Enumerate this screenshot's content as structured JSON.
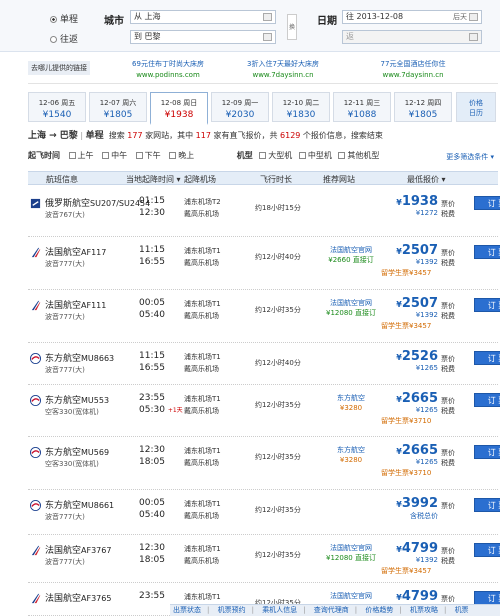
{
  "search": {
    "one_way": "单程",
    "round_trip": "往返",
    "city_label": "城市",
    "date_label": "日期",
    "from": "从 上海",
    "to": "到 巴黎",
    "depart_date": "往 2013-12-08",
    "depart_hint": "后天",
    "return_date": "返",
    "swap": "换"
  },
  "ads": {
    "intro": "去哪儿提供的链接",
    "items": [
      {
        "title": "69元住布丁时尚大床房",
        "url": "www.podinns.com"
      },
      {
        "title": "3折入住7天最好大床房",
        "url": "www.7daysinn.cn"
      },
      {
        "title": "77元全国酒店任你住",
        "url": "www.7daysinn.cn"
      }
    ]
  },
  "dates": [
    {
      "label": "12-06 周五",
      "price": "¥1540"
    },
    {
      "label": "12-07 周六",
      "price": "¥1805"
    },
    {
      "label": "12-08 周日",
      "price": "¥1938"
    },
    {
      "label": "12-09 周一",
      "price": "¥2030"
    },
    {
      "label": "12-10 周二",
      "price": "¥1830"
    },
    {
      "label": "12-11 周三",
      "price": "¥1088"
    },
    {
      "label": "12-12 周四",
      "price": "¥1805"
    }
  ],
  "trend": {
    "l1": "价格",
    "l2": "日历"
  },
  "summary": {
    "route": "上海 → 巴黎",
    "type": "单程",
    "t1": "搜索",
    "n1": "177",
    "t2": "家网站，其中",
    "n2": "117",
    "t3": "家有直飞报价，共",
    "n3": "6129",
    "t4": "个报价信息，搜索结束"
  },
  "filter": {
    "time_label": "起飞时间",
    "times": [
      "上午",
      "中午",
      "下午",
      "晚上"
    ],
    "type_label": "机型",
    "types": [
      "大型机",
      "中型机",
      "其他机型"
    ],
    "more": "更多筛选条件 ▾"
  },
  "table_headers": {
    "flight": "航班信息",
    "time": "当地起降时间 ▾",
    "airport": "起降机场",
    "duration": "飞行时长",
    "agent": "推荐网站",
    "price": "最低报价 ▾"
  },
  "flights": [
    {
      "airline": "俄罗斯航空",
      "code": "SU207/SU2454",
      "plane": "波音767(大)",
      "dep": "01:15",
      "arr": "12:30",
      "ap1": "浦东机场T2",
      "ap2": "戴高乐机场",
      "dur": "约18小时15分",
      "ag1": "",
      "ag2": "",
      "price": "1938",
      "ptag": "票价",
      "tax": "¥1272",
      "taxl": "税费",
      "ins": "",
      "insv": "",
      "book": "订 票"
    },
    {
      "airline": "法国航空",
      "code": "AF117",
      "plane": "波音777(大)",
      "dep": "11:15",
      "arr": "16:55",
      "ap1": "浦东机场T1",
      "ap2": "戴高乐机场",
      "dur": "约12小时40分",
      "ag1": "法国航空官网",
      "ag2": "¥2660 直接订",
      "price": "2507",
      "ptag": "票价",
      "tax": "¥1392",
      "taxl": "税费",
      "ins": "留学生票",
      "insv": "¥3457",
      "book": "订 票"
    },
    {
      "airline": "法国航空",
      "code": "AF111",
      "plane": "波音777(大)",
      "dep": "00:05",
      "arr": "05:40",
      "ap1": "浦东机场T1",
      "ap2": "戴高乐机场",
      "dur": "约12小时35分",
      "ag1": "法国航空官网",
      "ag2": "¥12080 直接订",
      "price": "2507",
      "ptag": "票价",
      "tax": "¥1392",
      "taxl": "税费",
      "ins": "留学生票",
      "insv": "¥3457",
      "book": "订 票"
    },
    {
      "airline": "东方航空",
      "code": "MU8663",
      "plane": "波音777(大)",
      "dep": "11:15",
      "arr": "16:55",
      "ap1": "浦东机场T1",
      "ap2": "戴高乐机场",
      "dur": "约12小时40分",
      "ag1": "",
      "ag2": "",
      "price": "2526",
      "ptag": "票价",
      "tax": "¥1265",
      "taxl": "税费",
      "ins": "",
      "insv": "",
      "book": "订 票"
    },
    {
      "airline": "东方航空",
      "code": "MU553",
      "plane": "空客330(宽体机)",
      "dep": "23:55",
      "arr": "05:30",
      "ap1": "浦东机场T1",
      "ap2": "戴高乐机场",
      "dur": "约12小时35分",
      "ag1": "东方航空",
      "ag2": "¥3280",
      "price": "2665",
      "ptag": "票价",
      "tax": "¥1265",
      "taxl": "税费",
      "ins": "留学生票",
      "insv": "¥3710",
      "book": "订 票"
    },
    {
      "airline": "东方航空",
      "code": "MU569",
      "plane": "空客330(宽体机)",
      "dep": "12:30",
      "arr": "18:05",
      "ap1": "浦东机场T1",
      "ap2": "戴高乐机场",
      "dur": "约12小时35分",
      "ag1": "东方航空",
      "ag2": "¥3280",
      "price": "2665",
      "ptag": "票价",
      "tax": "¥1265",
      "taxl": "税费",
      "ins": "留学生票",
      "insv": "¥3710",
      "book": "订 票"
    },
    {
      "airline": "东方航空",
      "code": "MU8661",
      "plane": "波音777(大)",
      "dep": "00:05",
      "arr": "05:40",
      "ap1": "浦东机场T1",
      "ap2": "戴高乐机场",
      "dur": "约12小时35分",
      "ag1": "",
      "ag2": "",
      "price": "3992",
      "ptag": "票价",
      "tax": "含税总价",
      "taxl": "",
      "ins": "",
      "insv": "",
      "book": "订 票"
    },
    {
      "airline": "法国航空",
      "code": "AF3767",
      "plane": "波音777(大)",
      "dep": "12:30",
      "arr": "18:05",
      "ap1": "浦东机场T1",
      "ap2": "戴高乐机场",
      "dur": "约12小时35分",
      "ag1": "法国航空官网",
      "ag2": "¥12080 直接订",
      "price": "4799",
      "ptag": "票价",
      "tax": "¥1392",
      "taxl": "税费",
      "ins": "留学生票",
      "insv": "¥3457",
      "book": "订 票"
    },
    {
      "airline": "法国航空",
      "code": "AF3765",
      "plane": "",
      "dep": "23:55",
      "arr": "",
      "ap1": "浦东机场T1",
      "ap2": "",
      "dur": "约12小时35分",
      "ag1": "法国航空官网",
      "ag2": "",
      "price": "4799",
      "ptag": "票价",
      "tax": "",
      "taxl": "",
      "ins": "",
      "insv": "",
      "book": "订 票"
    }
  ],
  "bottom": [
    "出票状态",
    "机票预约",
    "乘机人信息",
    "查询代理商",
    "价格趋势",
    "机票攻略",
    "机票"
  ],
  "colors": {
    "accent": "#2b6fd0",
    "price": "#1a5fb4",
    "warn": "#d26a00",
    "green": "#1a8a1a"
  }
}
